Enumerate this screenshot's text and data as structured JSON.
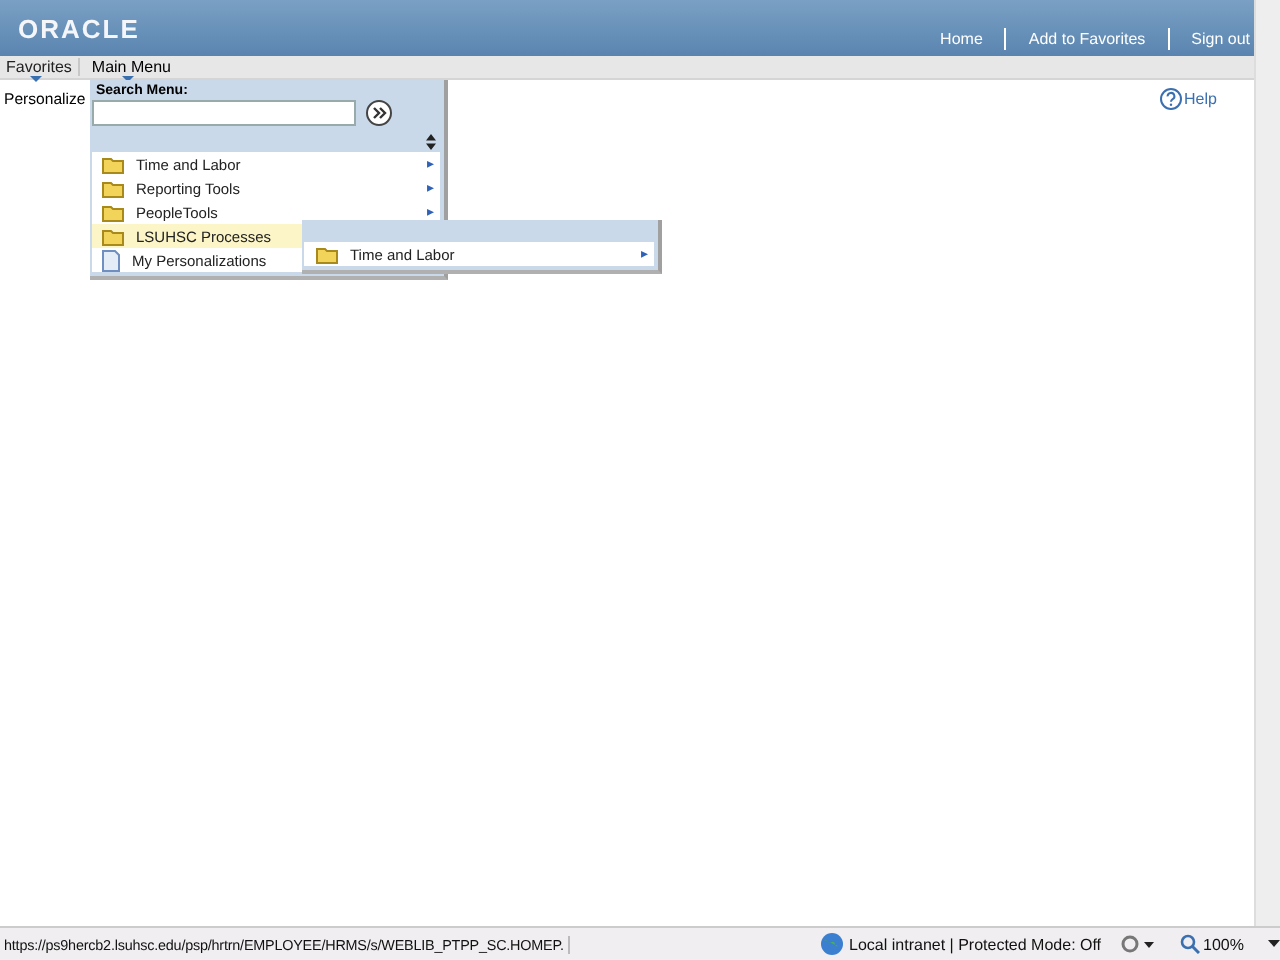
{
  "header": {
    "logo": "ORACLE",
    "links": [
      "Home",
      "Add to Favorites",
      "Sign out"
    ]
  },
  "menubar": [
    {
      "label": "Favorites",
      "selected": false
    },
    {
      "label": "Main Menu",
      "selected": true
    }
  ],
  "page": {
    "title": "Personalize",
    "help": "Help"
  },
  "main_menu": {
    "search_label": "Search Menu:",
    "items": [
      {
        "label": "Time and Labor",
        "kind": "folder",
        "selected": false,
        "arrow": "▸"
      },
      {
        "label": "Reporting Tools",
        "kind": "folder",
        "selected": false,
        "arrow": "▸"
      },
      {
        "label": "PeopleTools",
        "kind": "folder",
        "selected": false,
        "arrow": "▸"
      },
      {
        "label": "LSUHSC Processes",
        "kind": "folder",
        "selected": true
      },
      {
        "label": "My Personalizations",
        "kind": "page",
        "selected": false
      }
    ]
  },
  "submenu": {
    "items": [
      {
        "label": "Time and Labor",
        "kind": "folder",
        "selected": false,
        "arrow": "▸"
      }
    ]
  },
  "status_bar": {
    "url": "https://ps9hercb2.lsuhsc.edu/psp/hrtrn/EMPLOYEE/HRMS/s/WEBLIB_PTPP_SC.HOMEP.",
    "zone": "Local intranet | Protected Mode: Off",
    "zoom": "100%"
  }
}
